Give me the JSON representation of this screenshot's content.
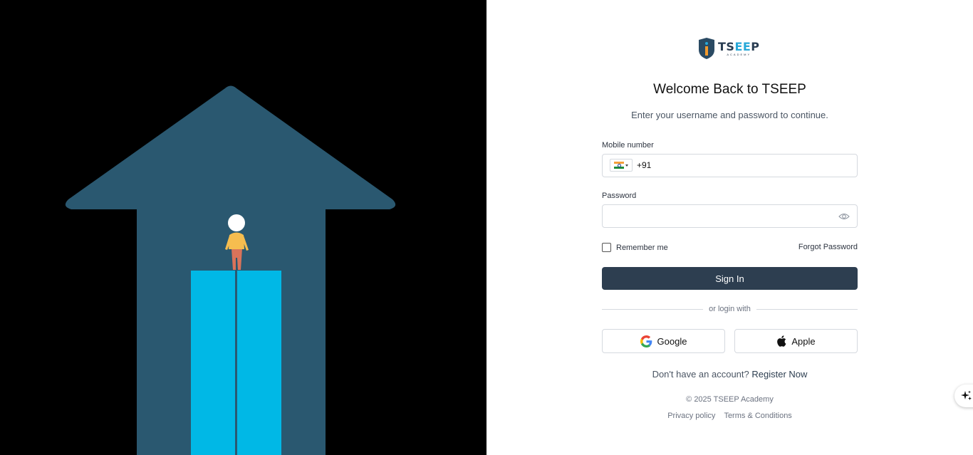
{
  "brand": {
    "name_part1": "TS",
    "name_part2": "EE",
    "name_part3": "P",
    "tagline": "ACADEMY"
  },
  "login": {
    "title": "Welcome Back to TSEEP",
    "subtitle": "Enter your username and password to continue.",
    "mobile_label": "Mobile number",
    "dial_code": "+91",
    "country_flag": "india-flag",
    "password_label": "Password",
    "password_value": "",
    "remember_label": "Remember me",
    "remember_checked": false,
    "forgot_label": "Forgot Password",
    "signin_label": "Sign In",
    "divider_text": "or login with",
    "google_label": "Google",
    "apple_label": "Apple",
    "register_prompt": "Don't have an account?",
    "register_link": "Register Now"
  },
  "footer": {
    "copyright": "© 2025 TSEEP Academy",
    "privacy": "Privacy policy",
    "terms": "Terms & Conditions"
  },
  "colors": {
    "left_background": "#000000",
    "arrow": "#2a5870",
    "door": "#00b8e6",
    "signin_button": "#2d3e50"
  }
}
